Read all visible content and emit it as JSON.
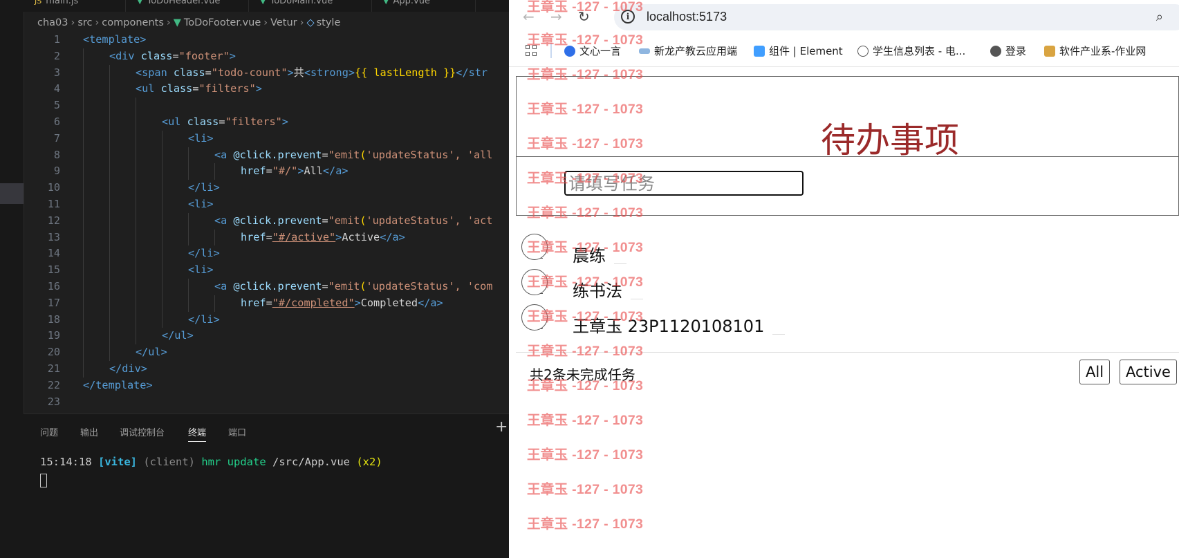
{
  "editor": {
    "tabs": [
      "main.js",
      "ToDoHeader.vue",
      "ToDoMain.vue",
      "App.vue"
    ],
    "breadcrumb": [
      "cha03",
      "src",
      "components",
      "ToDoFooter.vue",
      "Vetur",
      "style"
    ],
    "line_numbers": [
      "1",
      "2",
      "3",
      "4",
      "5",
      "6",
      "7",
      "8",
      "9",
      "10",
      "11",
      "12",
      "13",
      "14",
      "15",
      "16",
      "17",
      "18",
      "19",
      "20",
      "21",
      "22",
      "23"
    ],
    "code": {
      "l1_tag": "<template>",
      "l2_open": "<div",
      "l2_attr": "class",
      "l2_val": "\"footer\"",
      "l3_open": "<span",
      "l3_attr": "class",
      "l3_val": "\"todo-count\"",
      "l3_text": "共",
      "l3_strong": "<strong>",
      "l3_interp": "{{ lastLength }}",
      "l3_close": "</str",
      "l4_open": "<ul",
      "l4_attr": "class",
      "l4_val": "\"filters\"",
      "l6_open": "<ul",
      "l6_attr": "class",
      "l6_val": "\"filters\"",
      "li_open": "<li>",
      "li_close": "</li>",
      "a_open": "<a",
      "click_attr": "@click",
      "prevent": ".prevent",
      "emit_open": "\"emit",
      "paren": "(",
      "status_arg": "'updateStatus'",
      "comma": ", ",
      "l8_arg": "'all",
      "l12_arg": "'act",
      "l16_arg": "'com",
      "href_attr": "href",
      "href_all_val": "\"#/\"",
      "href_active_val": "\"#/active\"",
      "href_completed_val": "\"#/completed\"",
      "a_close": "</a>",
      "all_text": "All",
      "active_text": "Active",
      "completed_text": "Completed",
      "ul_close": "</ul>",
      "div_close": "</div>",
      "template_close": "</template>"
    },
    "panel_tabs": [
      "问题",
      "输出",
      "调试控制台",
      "终端",
      "端口"
    ],
    "terminal": {
      "time": "15:14:18",
      "vite": "[vite]",
      "client": "(client)",
      "hmr": "hmr update",
      "path": "/src/App.vue",
      "count": "(x2)"
    }
  },
  "browser": {
    "url": "localhost:5173",
    "bookmarks": [
      "文心一言",
      "新龙产教云应用端",
      "组件 | Element",
      "学生信息列表 - 电...",
      "登录",
      "软件产业系-作业网"
    ],
    "app": {
      "title": "待办事项",
      "input_placeholder": "请填写任务",
      "todos": [
        "晨练",
        "练书法",
        "王章玉 23P1120108101"
      ],
      "footer_count": "共2条未完成任务",
      "filter_all": "All",
      "filter_active": "Active"
    }
  },
  "watermark": "王章玉 -127 - 1073",
  "colors": {
    "editor_bg": "#1f1f1f",
    "title_red": "#9b2a2a",
    "watermark": "#e94a4a",
    "vue_green": "#41b883"
  }
}
